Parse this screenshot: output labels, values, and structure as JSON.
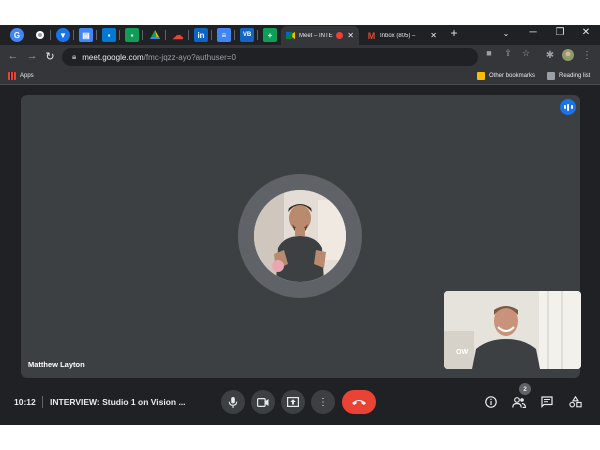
{
  "browser": {
    "tabs": [
      {
        "title": "Meet – INTE",
        "active": true
      },
      {
        "title": "Inbox (805) – ",
        "active": false
      }
    ],
    "new_tab_symbol": "+",
    "url_host": "meet.google.com",
    "url_path": "/fmc-jqzz-ayo?authuser=0"
  },
  "bookmarks": {
    "apps": "Apps",
    "other": "Other bookmarks",
    "reading": "Reading list"
  },
  "meet": {
    "speaker_name": "Matthew Layton",
    "self_label": "OW",
    "clock": "10:12",
    "meeting_title": "INTERVIEW: Studio 1 on Vision ...",
    "participant_count": "2"
  },
  "colors": {
    "accent_blue": "#1a73e8",
    "end_call_red": "#ea4335",
    "stage_bg": "#3c4043",
    "page_bg": "#202124"
  },
  "icons": {
    "controls": [
      "microphone-icon",
      "camera-icon",
      "present-icon",
      "more-options-icon",
      "end-call-icon"
    ],
    "right": [
      "info-icon",
      "people-icon",
      "chat-icon",
      "activities-icon"
    ]
  }
}
